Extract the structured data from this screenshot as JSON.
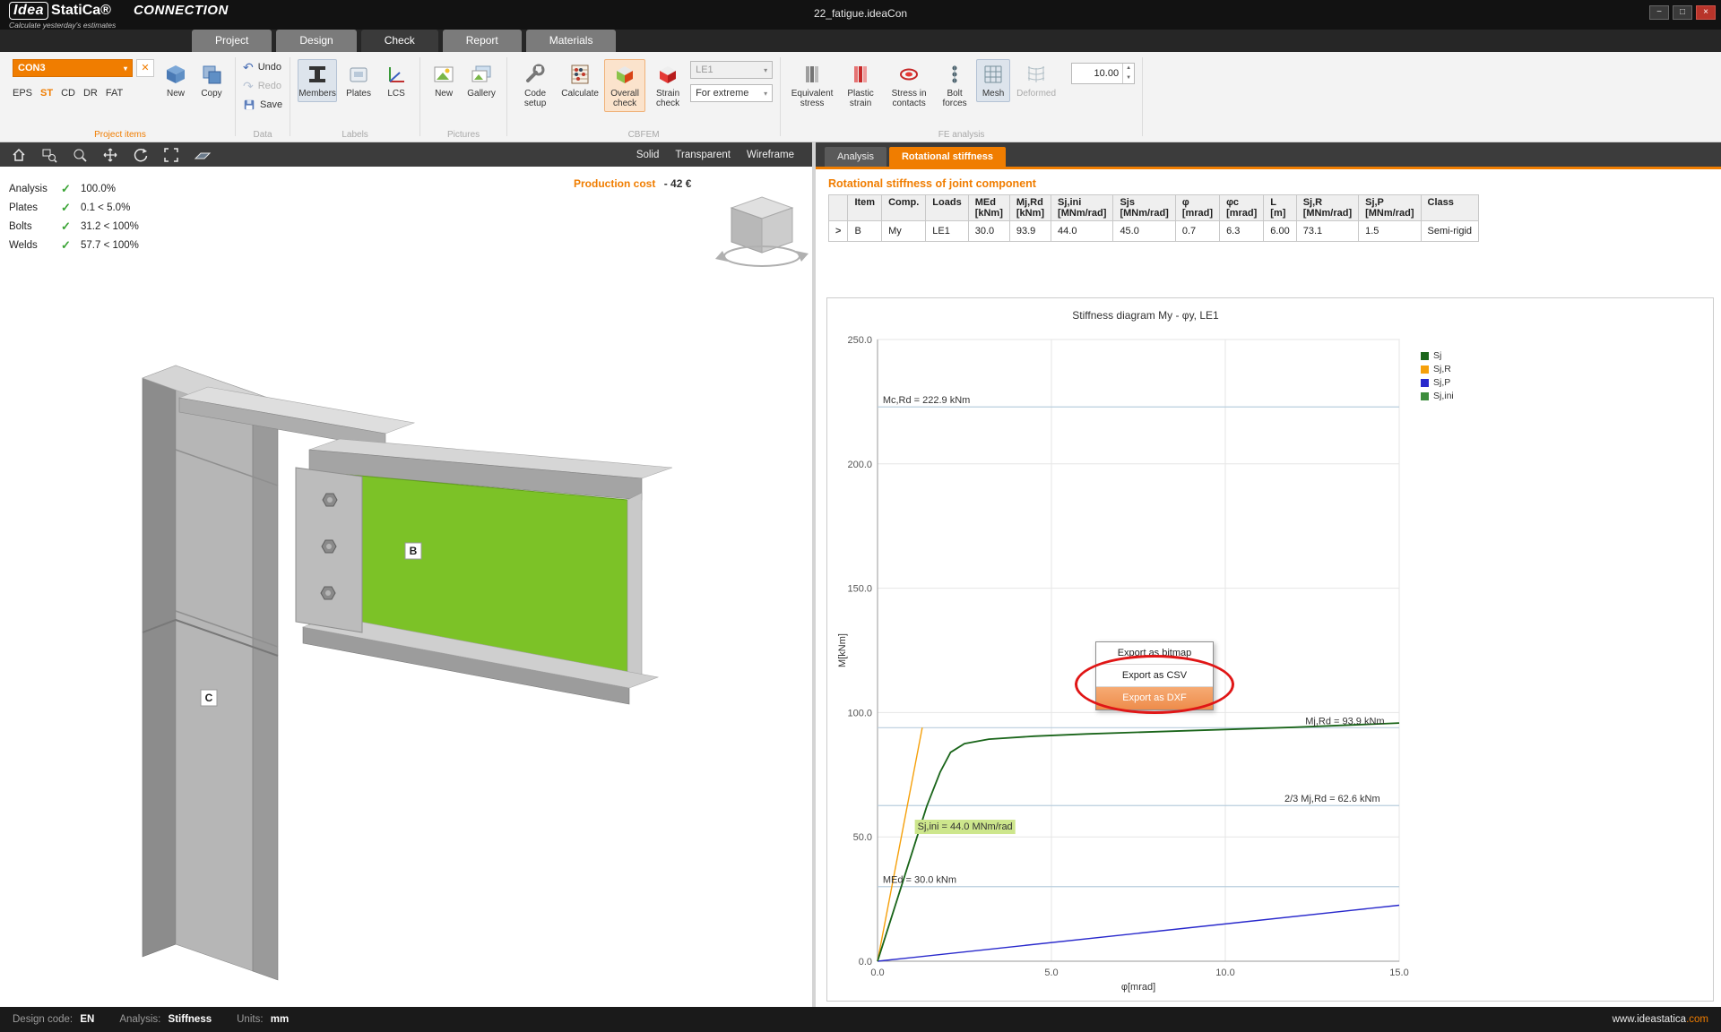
{
  "titlebar": {
    "logo_primary": "Idea",
    "logo_secondary": "StatiCa®",
    "app_name": "CONNECTION",
    "tagline": "Calculate yesterday's estimates",
    "document_title": "22_fatigue.ideaCon"
  },
  "icons": {
    "check": "✓",
    "dropdown": "▾",
    "undo": "↶",
    "redo": "↷",
    "spin_up": "▲",
    "spin_down": "▼",
    "minimize": "−",
    "maximize": "□",
    "close": "×",
    "delete_item": "✕"
  },
  "tabs": {
    "items": [
      "Project",
      "Design",
      "Check",
      "Report",
      "Materials"
    ],
    "active": "Check"
  },
  "ribbon": {
    "groups": {
      "project_items": {
        "label": "Project items",
        "combo_value": "CON3",
        "modes": [
          "EPS",
          "ST",
          "CD",
          "DR",
          "FAT"
        ],
        "active_mode": "ST",
        "new": "New",
        "copy": "Copy"
      },
      "data": {
        "label": "Data",
        "undo": "Undo",
        "redo": "Redo",
        "save": "Save"
      },
      "labels": {
        "label": "Labels",
        "members": "Members",
        "plates": "Plates",
        "lcs": "LCS"
      },
      "pictures": {
        "label": "Pictures",
        "new": "New",
        "gallery": "Gallery"
      },
      "cbfem": {
        "label": "CBFEM",
        "code_setup": "Code setup",
        "calculate": "Calculate",
        "overall_check": "Overall check",
        "strain_check": "Strain check",
        "load_combo": "LE1",
        "extreme_combo": "For extreme"
      },
      "fe_analysis": {
        "label": "FE analysis",
        "equivalent_stress": "Equivalent stress",
        "plastic_strain": "Plastic strain",
        "stress_contacts": "Stress in contacts",
        "bolt_forces": "Bolt forces",
        "mesh": "Mesh",
        "deformed": "Deformed",
        "scale_value": "10.00"
      }
    }
  },
  "viewport": {
    "view_modes": [
      "Solid",
      "Transparent",
      "Wireframe"
    ],
    "checks": [
      {
        "label": "Analysis",
        "value": "100.0%"
      },
      {
        "label": "Plates",
        "value": "0.1 < 5.0%"
      },
      {
        "label": "Bolts",
        "value": "31.2 < 100%"
      },
      {
        "label": "Welds",
        "value": "57.7 < 100%"
      }
    ],
    "production_cost_label": "Production cost",
    "production_cost_value": "-  42 €",
    "label_b": "B",
    "label_c": "C"
  },
  "panel": {
    "tabs": [
      "Analysis",
      "Rotational stiffness"
    ],
    "active_tab": "Rotational stiffness",
    "section_title": "Rotational stiffness of joint component",
    "table": {
      "headers": [
        "Item",
        "Comp.",
        "Loads",
        "MEd\n[kNm]",
        "Mj,Rd\n[kNm]",
        "Sj,ini\n[MNm/rad]",
        "Sjs\n[MNm/rad]",
        "φ\n[mrad]",
        "φc\n[mrad]",
        "L\n[m]",
        "Sj,R\n[MNm/rad]",
        "Sj,P\n[MNm/rad]",
        "Class"
      ],
      "row": {
        "expander": ">",
        "cells": [
          "B",
          "My",
          "LE1",
          "30.0",
          "93.9",
          "44.0",
          "45.0",
          "0.7",
          "6.3",
          "6.00",
          "73.1",
          "1.5",
          "Semi-rigid"
        ]
      }
    },
    "context_menu": {
      "items": [
        "Export as bitmap",
        "Export as CSV",
        "Export as DXF"
      ],
      "highlighted": "Export as DXF"
    }
  },
  "chart_data": {
    "type": "line",
    "title": "Stiffness diagram My - φy, LE1",
    "xlabel": "φ[mrad]",
    "ylabel": "M[kNm]",
    "xlim": [
      0,
      15
    ],
    "ylim": [
      0,
      250
    ],
    "xticks": [
      0,
      5,
      10,
      15
    ],
    "yticks": [
      0,
      50,
      100,
      150,
      200,
      250
    ],
    "grid": true,
    "legend_position": "top-right",
    "series": [
      {
        "name": "Sj",
        "color": "#1a651a",
        "points": [
          [
            0,
            0
          ],
          [
            0.7,
            30.8
          ],
          [
            1.42,
            62.5
          ],
          [
            1.8,
            76
          ],
          [
            2.1,
            84
          ],
          [
            2.5,
            87.5
          ],
          [
            3.2,
            89.3
          ],
          [
            4.5,
            90.5
          ],
          [
            6,
            91.4
          ],
          [
            8,
            92.3
          ],
          [
            10,
            93.2
          ],
          [
            12,
            94.1
          ],
          [
            15,
            95.8
          ]
        ]
      },
      {
        "name": "Sj,R",
        "color": "#f5a00a",
        "points": [
          [
            0,
            0
          ],
          [
            1.285,
            93.9
          ]
        ]
      },
      {
        "name": "Sj,P",
        "color": "#2929cc",
        "points": [
          [
            0,
            0
          ],
          [
            15,
            22.5
          ]
        ]
      },
      {
        "name": "Sj,ini",
        "color": "#3c8c3c",
        "points": [
          [
            0,
            0
          ],
          [
            1.42,
            62.5
          ]
        ]
      }
    ],
    "annotations": [
      {
        "text": "Mc,Rd = 222.9 kNm",
        "y": 222.9,
        "label_x": 0.15,
        "highlight": false,
        "no_line": false
      },
      {
        "text": "Mj,Rd = 93.9 kNm",
        "y": 93.9,
        "label_x": 12.3,
        "highlight": false,
        "no_line": false
      },
      {
        "text": "2/3 Mj,Rd = 62.6 kNm",
        "y": 62.6,
        "label_x": 11.7,
        "highlight": false,
        "no_line": false
      },
      {
        "text": "MEd = 30.0 kNm",
        "y": 30.0,
        "label_x": 0.15,
        "highlight": false,
        "no_line": false
      },
      {
        "text": "Sj,ini = 44.0 MNm/rad",
        "y": 51.5,
        "label_x": 1.15,
        "highlight": true,
        "no_line": true
      }
    ]
  },
  "statusbar": {
    "design_code_label": "Design code:",
    "design_code_value": "EN",
    "analysis_label": "Analysis:",
    "analysis_value": "Stiffness",
    "units_label": "Units:",
    "units_value": "mm",
    "website_base": "www.ideastatica",
    "website_tld": ".com"
  }
}
